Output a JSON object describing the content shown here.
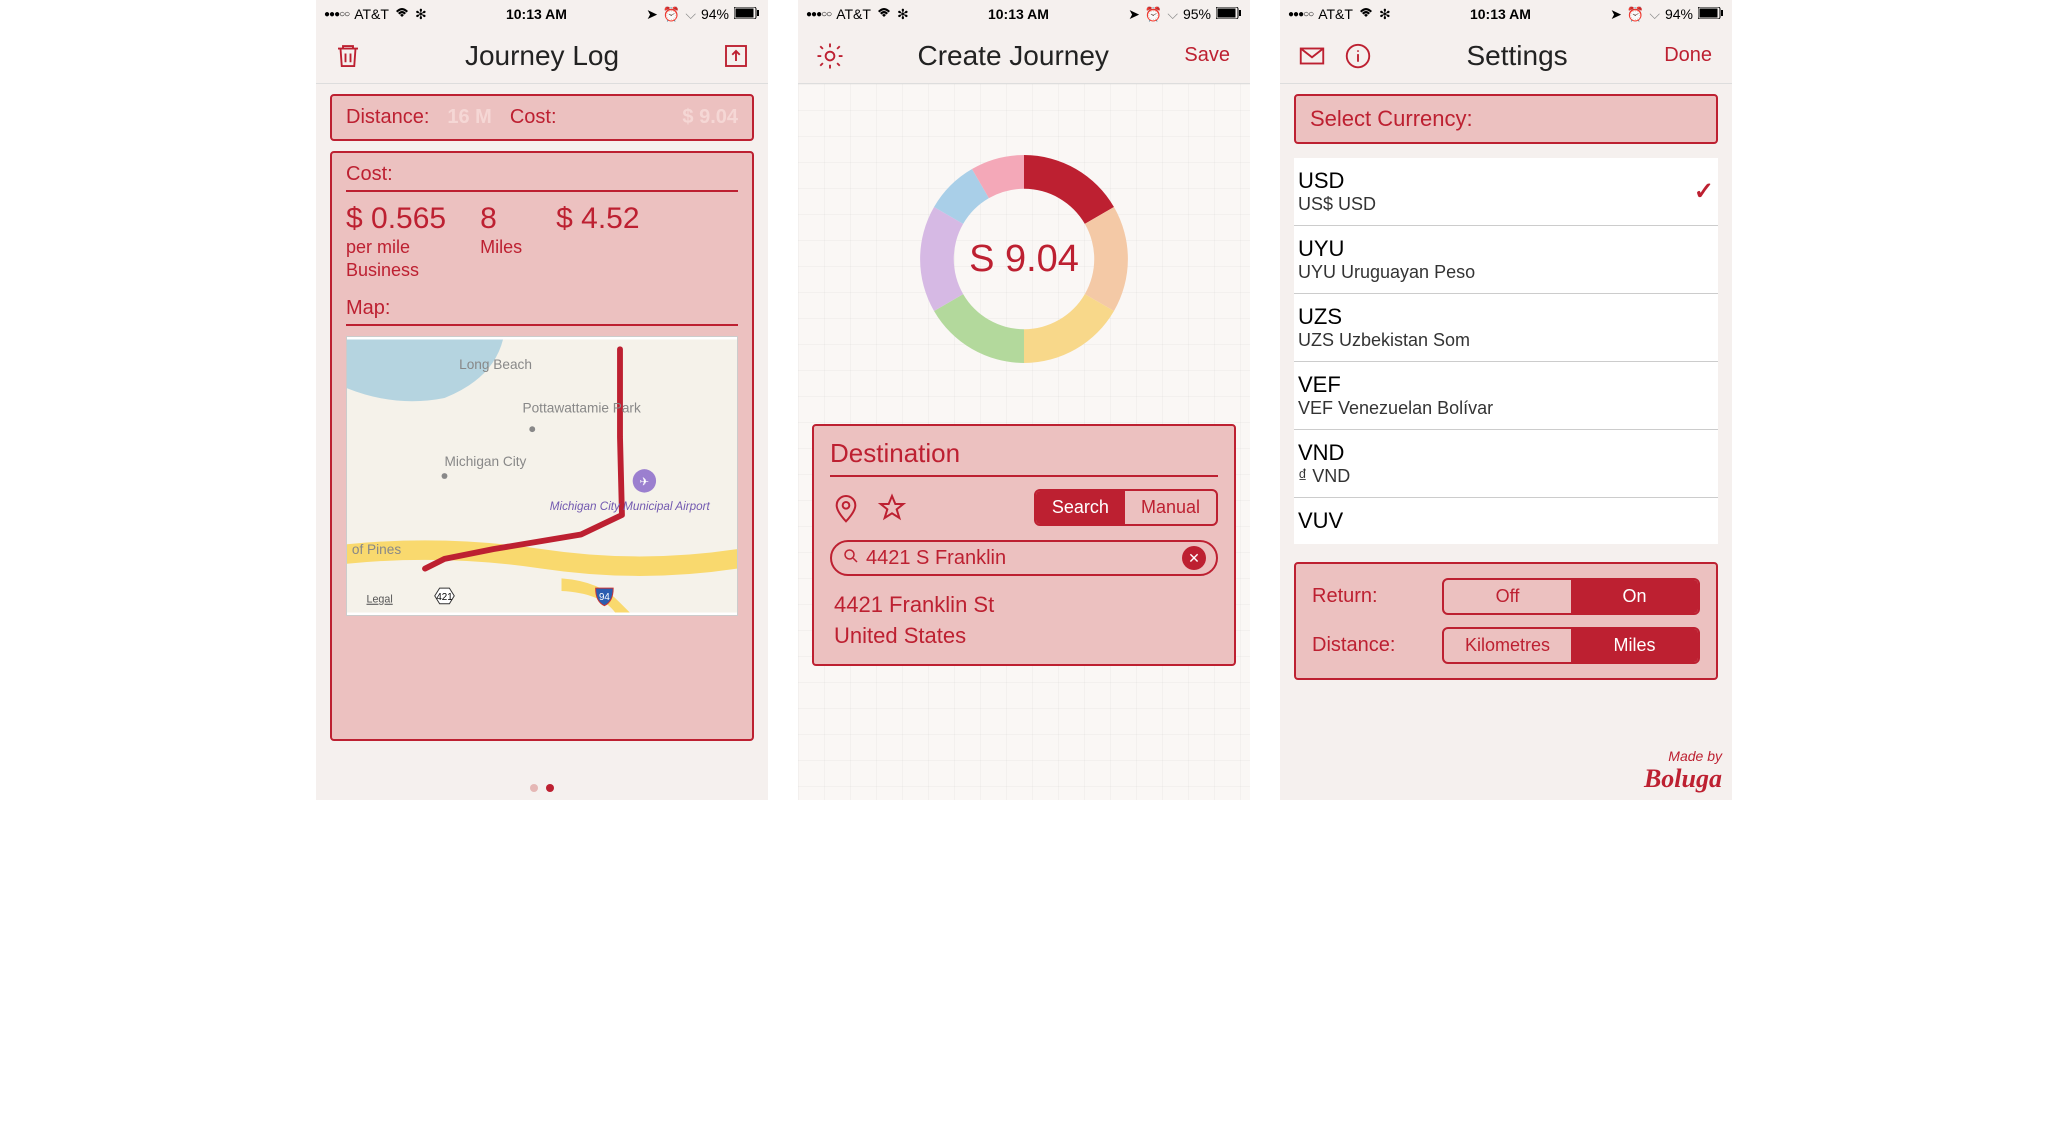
{
  "status": {
    "dots": "●●●○○",
    "carrier": "AT&T",
    "time": "10:13 AM",
    "batt1": "94%",
    "batt2": "95%",
    "batt3": "94%"
  },
  "s1": {
    "title": "Journey Log",
    "sum_dist_label": "Distance:",
    "sum_dist_val": "16 M",
    "sum_cost_label": "Cost:",
    "sum_cost_val": "$ 9.04",
    "cost_label": "Cost:",
    "rate": "$ 0.565",
    "rate_sub1": "per mile",
    "rate_sub2": "Business",
    "miles_val": "8",
    "miles_lbl": "Miles",
    "total": "$ 4.52",
    "map_label": "Map:",
    "map_places": {
      "p1": "Long Beach",
      "p2": "Pottawattamie Park",
      "p3": "Michigan City",
      "p4": "Michigan City Municipal Airport",
      "p5": "of Pines",
      "legal": "Legal",
      "r421": "421",
      "r94": "94"
    }
  },
  "s2": {
    "title": "Create Journey",
    "save": "Save",
    "amount": "S 9.04",
    "dest_title": "Destination",
    "seg_search": "Search",
    "seg_manual": "Manual",
    "search_val": "4421 S Franklin",
    "res_line1": "4421 Franklin St",
    "res_line2": "United States"
  },
  "s3": {
    "title": "Settings",
    "done": "Done",
    "sel_curr": "Select Currency:",
    "currencies": {
      "c0": {
        "code": "USD",
        "desc": "US$  USD"
      },
      "c1": {
        "code": "UYU",
        "desc": "UYU  Uruguayan Peso"
      },
      "c2": {
        "code": "UZS",
        "desc": "UZS  Uzbekistan Som"
      },
      "c3": {
        "code": "VEF",
        "desc": "VEF  Venezuelan Bolívar"
      },
      "c4": {
        "code": "VND",
        "desc": "₫  VND"
      },
      "c5": {
        "code": "VUV",
        "desc": ""
      }
    },
    "return_lbl": "Return:",
    "off": "Off",
    "on": "On",
    "dist_lbl": "Distance:",
    "km": "Kilometres",
    "mi": "Miles",
    "brand_sm": "Made by",
    "brand_big": "Boluga"
  },
  "chart_data": {
    "type": "pie",
    "title": "S 9.04",
    "slices": [
      {
        "color": "#BD2031",
        "fraction": 0.167
      },
      {
        "color": "#F4C9A6",
        "fraction": 0.167
      },
      {
        "color": "#F8D88A",
        "fraction": 0.167
      },
      {
        "color": "#B3D99C",
        "fraction": 0.167
      },
      {
        "color": "#D6B9E4",
        "fraction": 0.167
      },
      {
        "color": "#A9CFE8",
        "fraction": 0.083
      },
      {
        "color": "#F4A8B8",
        "fraction": 0.083
      }
    ]
  }
}
